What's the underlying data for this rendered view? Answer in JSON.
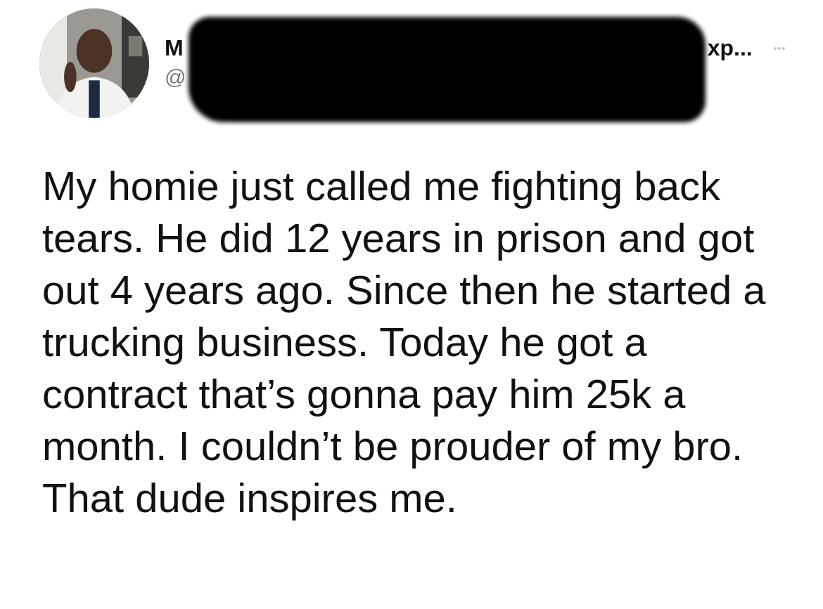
{
  "header": {
    "name_start": "M",
    "name_end": "xp...",
    "handle_start": "@",
    "redacted": true,
    "more": "•••"
  },
  "tweet": {
    "text": "My homie just called me fighting back tears. He did 12 years in prison and got out 4 years ago. Since then he started a trucking business. Today he got a contract that’s gonna pay him 25k a month. I couldn’t be prouder of my bro. That dude inspires me."
  }
}
